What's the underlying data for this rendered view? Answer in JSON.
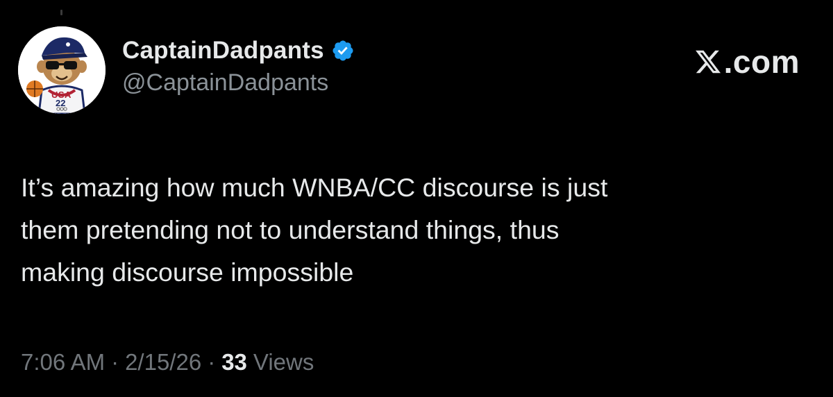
{
  "user": {
    "display_name": "CaptainDadpants",
    "handle": "@CaptainDadpants",
    "verified": true,
    "avatar_jersey_text": "USA",
    "avatar_jersey_number": "22"
  },
  "brand": {
    "text": ".com",
    "logo_icon": "x-logo-icon"
  },
  "tweet": {
    "text": "It’s amazing how much WNBA/CC discourse is just\nthem pretending not to understand things, thus\nmaking discourse impossible"
  },
  "meta": {
    "time": "7:06 AM",
    "separator": "·",
    "date": "2/15/26",
    "views_count": "33",
    "views_label": "Views"
  },
  "colors": {
    "background": "#000000",
    "primary_text": "#e7e9ea",
    "secondary_text": "#71767b",
    "verified_badge": "#1d9bf0"
  }
}
